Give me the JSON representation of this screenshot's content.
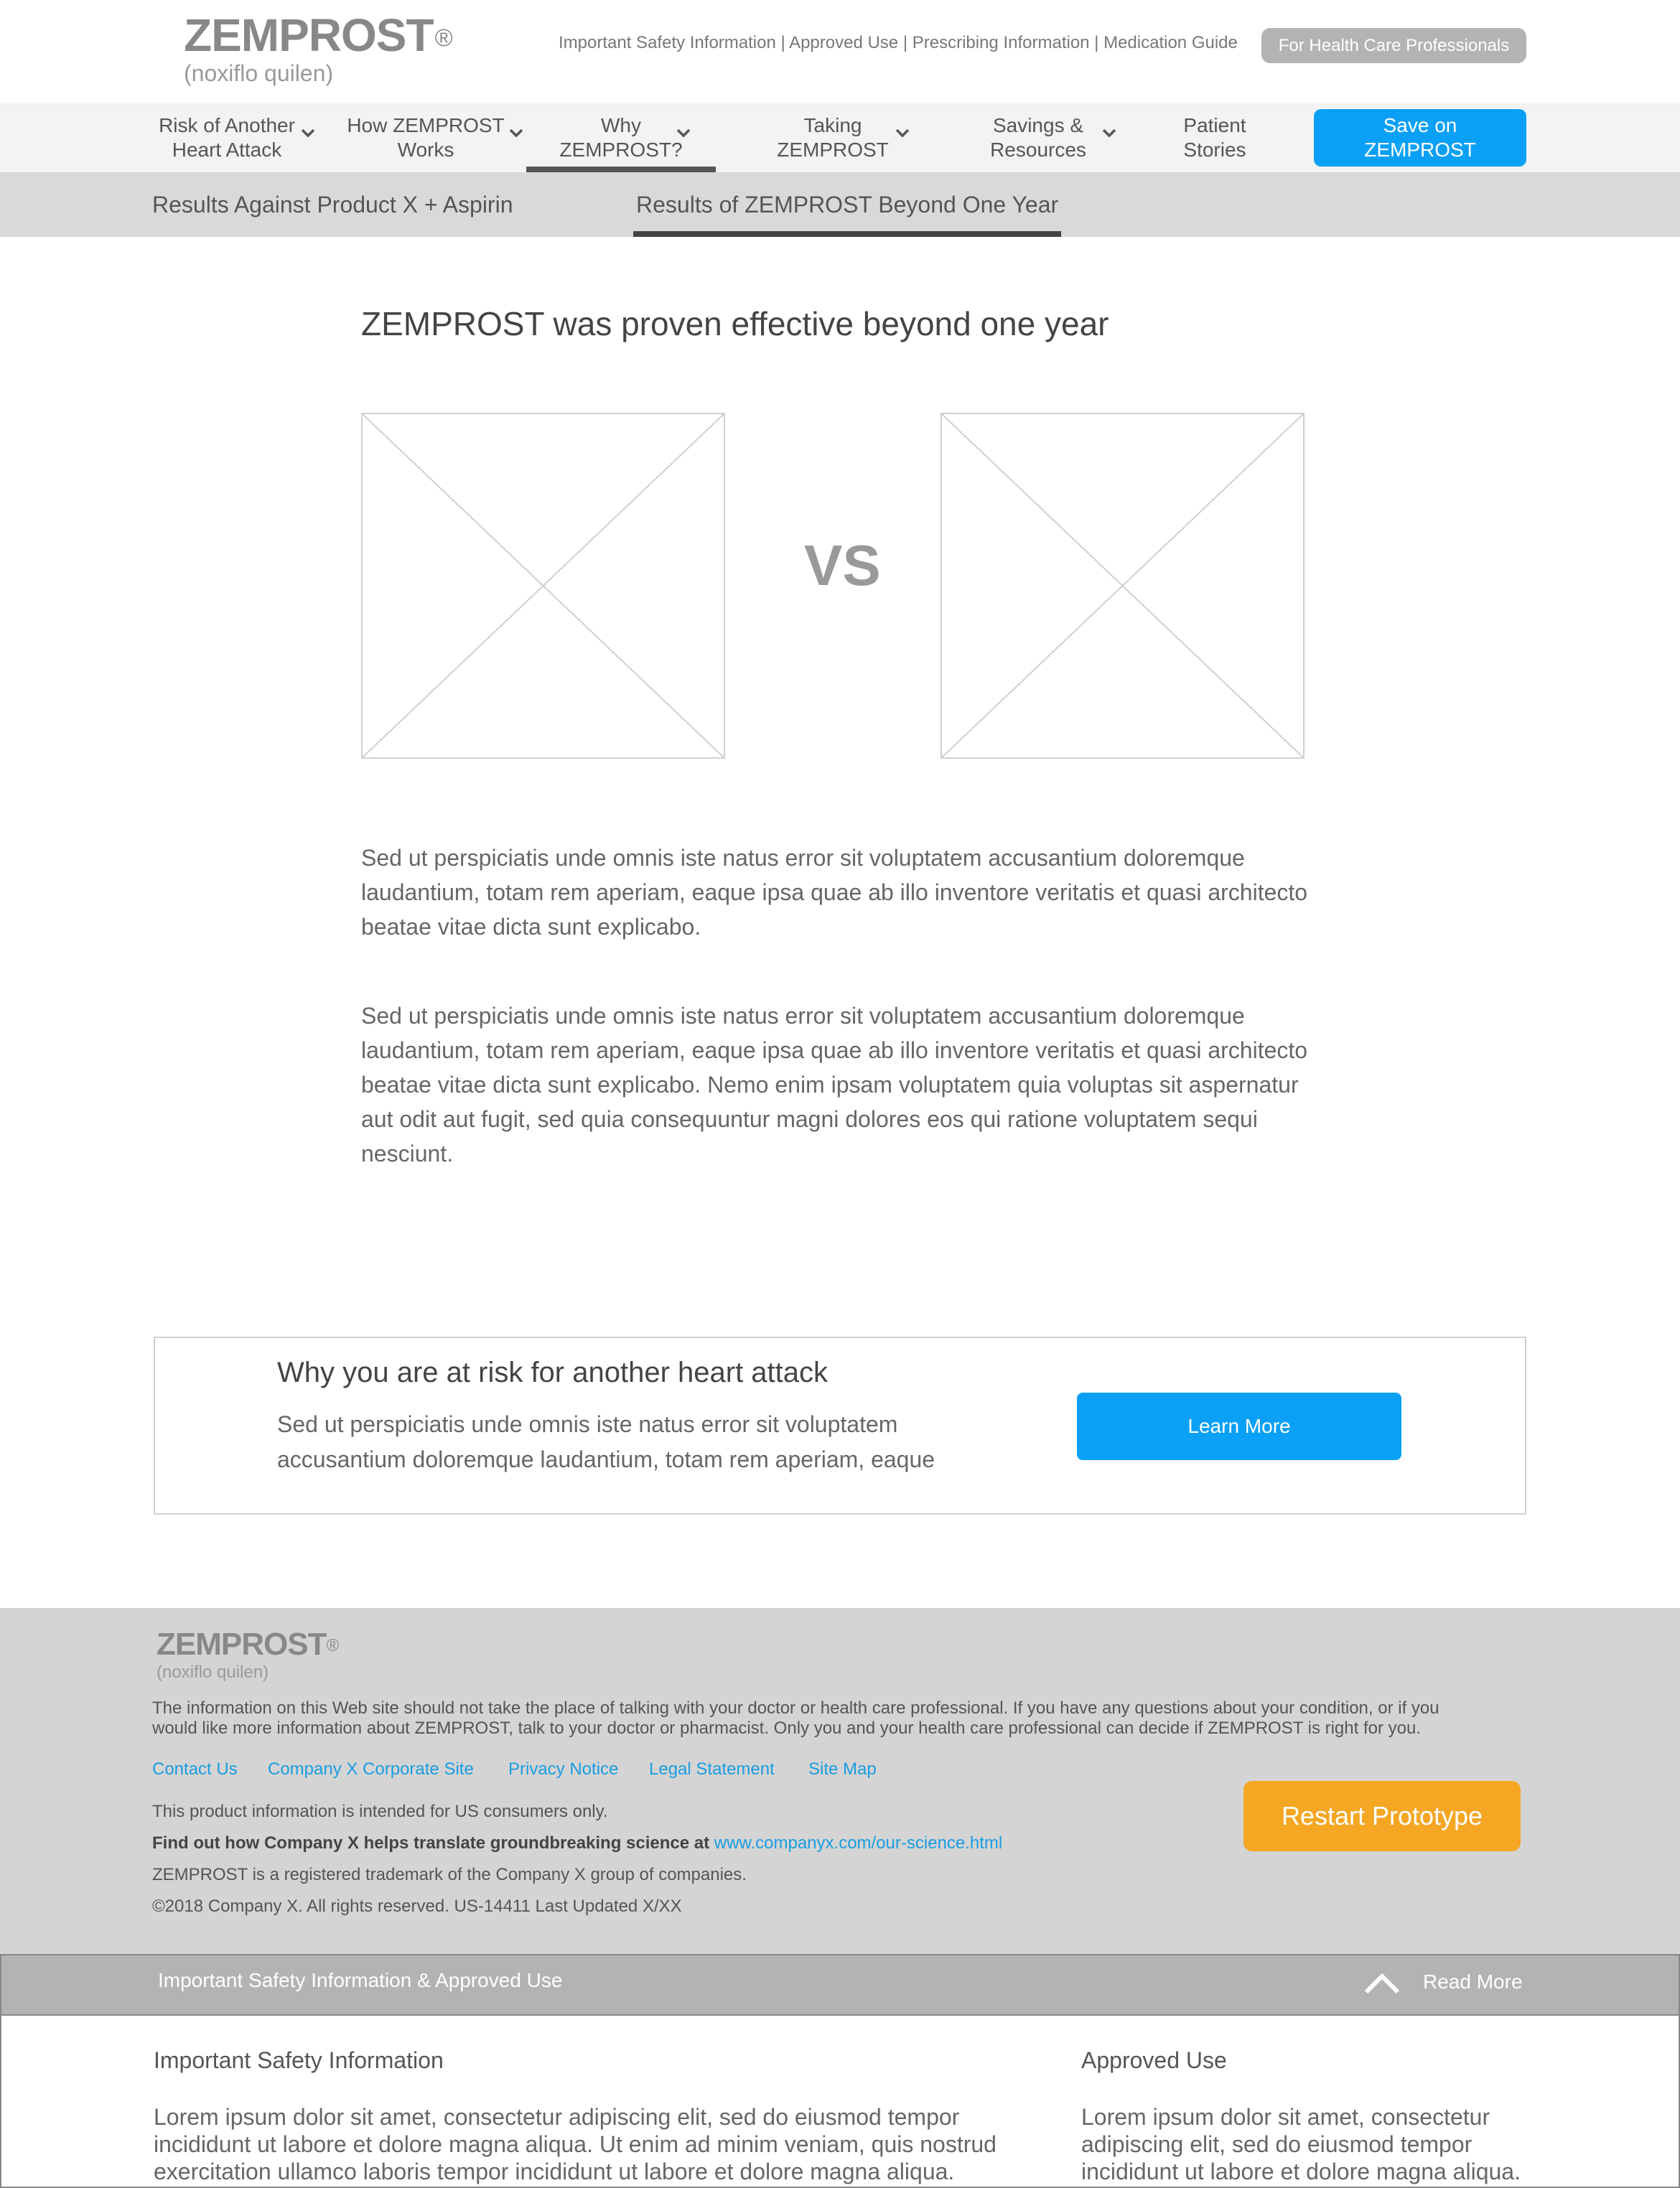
{
  "header": {
    "brand_name": "ZEMPROST",
    "brand_reg": "®",
    "brand_generic": "(noxiflo quilen)",
    "util_links": [
      "Important Safety Information",
      "Approved Use",
      "Prescribing Information",
      "Medication Guide"
    ],
    "util_sep": " | ",
    "hcp_button": "For Health Care Professionals"
  },
  "nav": {
    "items": [
      {
        "line1": "Risk of Another",
        "line2": "Heart Attack"
      },
      {
        "line1": "How ZEMPROST",
        "line2": "Works"
      },
      {
        "line1": "Why",
        "line2": "ZEMPROST?"
      },
      {
        "line1": "Taking",
        "line2": "ZEMPROST"
      },
      {
        "line1": "Savings &",
        "line2": "Resources"
      },
      {
        "line1": "Patient",
        "line2": "Stories"
      }
    ],
    "save_line1": "Save on",
    "save_line2": "ZEMPROST"
  },
  "subnav": {
    "tabs": [
      "Results Against Product X  + Aspirin",
      "Results of ZEMPROST Beyond One Year"
    ]
  },
  "main": {
    "title": "ZEMPROST was proven effective beyond one year",
    "vs": "VS",
    "paragraphs": [
      "Sed ut perspiciatis unde omnis iste natus error sit voluptatem accusantium doloremque laudantium, totam rem aperiam, eaque ipsa quae ab illo inventore veritatis et quasi architecto beatae vitae dicta sunt explicabo.",
      "Sed ut perspiciatis unde omnis iste natus error sit voluptatem accusantium doloremque laudantium, totam rem aperiam, eaque ipsa quae ab illo inventore veritatis et quasi architecto beatae vitae dicta sunt explicabo. Nemo enim ipsam voluptatem quia voluptas sit aspernatur aut odit aut fugit, sed quia consequuntur magni dolores eos qui ratione voluptatem sequi nesciunt."
    ]
  },
  "cta": {
    "title": "Why you are at risk for another heart attack",
    "text": "Sed ut perspiciatis unde omnis iste natus error sit voluptatem accusantium doloremque laudantium, totam rem aperiam, eaque",
    "button": "Learn More"
  },
  "footer": {
    "brand_name": "ZEMPROST",
    "brand_reg": "®",
    "brand_generic": "(noxiflo quilen)",
    "disclaimer": "The information on this Web site should not take the place of talking with your doctor or health care professional. If you have any questions about your condition, or if you would like more information about ZEMPROST, talk to your doctor or pharmacist. Only you and your health care professional can decide if ZEMPROST is right for you.",
    "links": [
      "Contact Us",
      "Company X Corporate Site",
      "Privacy Notice",
      "Legal Statement",
      "Site Map"
    ],
    "us_only": "This product information is intended for US consumers only.",
    "science_bold": "Find out how Company X helps translate groundbreaking science at",
    "science_link": "www.companyx.com/our-science.html",
    "trademark": "ZEMPROST is a registered trademark of the Company X group of companies.",
    "copyright": "©2018 Company X. All rights reserved. US-14411 Last Updated X/XX",
    "restart_button": "Restart Prototype"
  },
  "isi": {
    "bar_title": "Important Safety Information & Approved Use",
    "read_more": "Read More",
    "left_heading": "Important Safety Information",
    "left_text": "Lorem ipsum dolor sit amet, consectetur adipiscing elit, sed do eiusmod tempor incididunt ut labore et dolore magna aliqua. Ut enim ad minim veniam, quis nostrud exercitation ullamco laboris tempor incididunt ut labore et dolore magna aliqua.",
    "right_heading": "Approved Use",
    "right_text": "Lorem ipsum dolor sit amet, consectetur adipiscing elit, sed do eiusmod tempor incididunt ut labore et dolore magna aliqua."
  },
  "colors": {
    "accent_blue": "#0aa0f5",
    "link_blue": "#1a9de0",
    "restart_orange": "#f5a623",
    "chip_gray": "#b3b3b3"
  },
  "icons": [
    "chevron-down-icon",
    "chevron-up-icon",
    "image-placeholder"
  ]
}
